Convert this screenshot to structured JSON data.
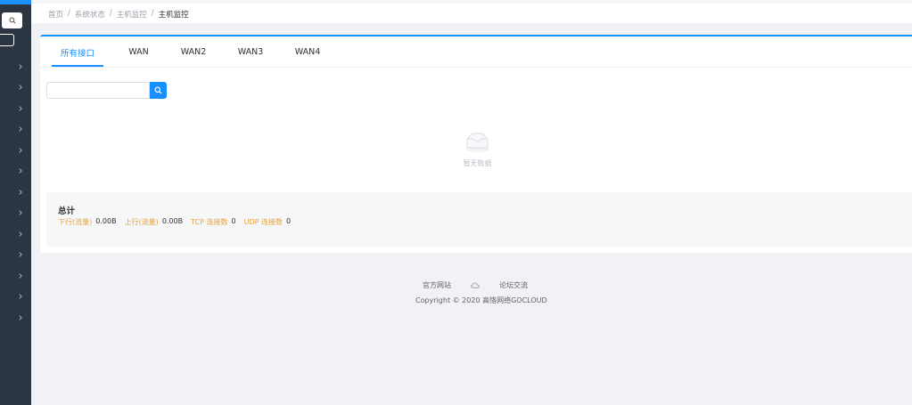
{
  "breadcrumb": {
    "items": [
      "首页",
      "系统状态",
      "主机监控",
      "主机监控"
    ],
    "separator": "/"
  },
  "tabs": [
    {
      "label": "所有接口",
      "active": true
    },
    {
      "label": "WAN",
      "active": false
    },
    {
      "label": "WAN2",
      "active": false
    },
    {
      "label": "WAN3",
      "active": false
    },
    {
      "label": "WAN4",
      "active": false
    }
  ],
  "search": {
    "value": "",
    "placeholder": "",
    "button_icon": "search-icon"
  },
  "empty": {
    "text": "暂无数据",
    "icon": "empty-box-icon"
  },
  "summary": {
    "title": "总计",
    "fields": [
      {
        "label": "下行(流量)",
        "value": "0.00B"
      },
      {
        "label": "上行(流量)",
        "value": "0.00B"
      },
      {
        "label": "TCP 连接数",
        "value": "0"
      },
      {
        "label": "UDP 连接数",
        "value": "0"
      }
    ]
  },
  "footer": {
    "links": [
      "官方网站",
      "论坛交流"
    ],
    "cloud_icon": "cloud-icon",
    "copyright": "Copyright © 2020 高恪网络GOCLOUD"
  },
  "colors": {
    "accent": "#1890ff",
    "sidebar": "#2b3642",
    "warning_label": "#e6a23c"
  }
}
